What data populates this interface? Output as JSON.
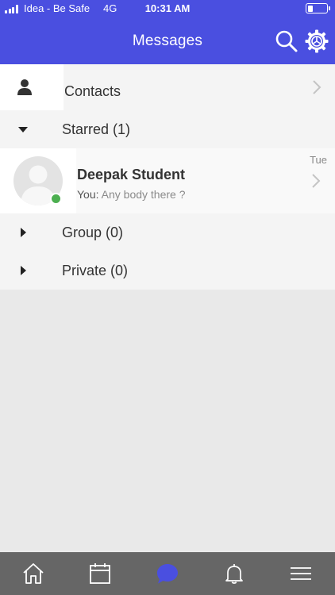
{
  "status_bar": {
    "carrier": "Idea - Be Safe",
    "network": "4G",
    "time": "10:31 AM",
    "signal_bars": 4,
    "battery_level": 0.3
  },
  "header": {
    "title": "Messages",
    "background_color": "#4a4fe0",
    "search_icon": "search-icon",
    "settings_icon": "settings-icon"
  },
  "contacts": {
    "label": "Contacts",
    "icon": "person-icon"
  },
  "sections": {
    "starred": {
      "label": "Starred (1)",
      "expanded": true
    },
    "group": {
      "label": "Group (0)",
      "expanded": false
    },
    "private": {
      "label": "Private (0)",
      "expanded": false
    }
  },
  "conversation": {
    "name": "Deepak Student",
    "prefix": "You:",
    "message": "Any body there ?",
    "date": "Tue",
    "online": true,
    "presence_color": "#4caf50"
  },
  "tabbar": {
    "background_color": "#666666",
    "active_color": "#4a4fe0",
    "items": [
      {
        "icon": "home-icon",
        "active": false
      },
      {
        "icon": "calendar-icon",
        "active": false
      },
      {
        "icon": "messages-icon",
        "active": true
      },
      {
        "icon": "bell-icon",
        "active": false
      },
      {
        "icon": "menu-icon",
        "active": false
      }
    ]
  }
}
